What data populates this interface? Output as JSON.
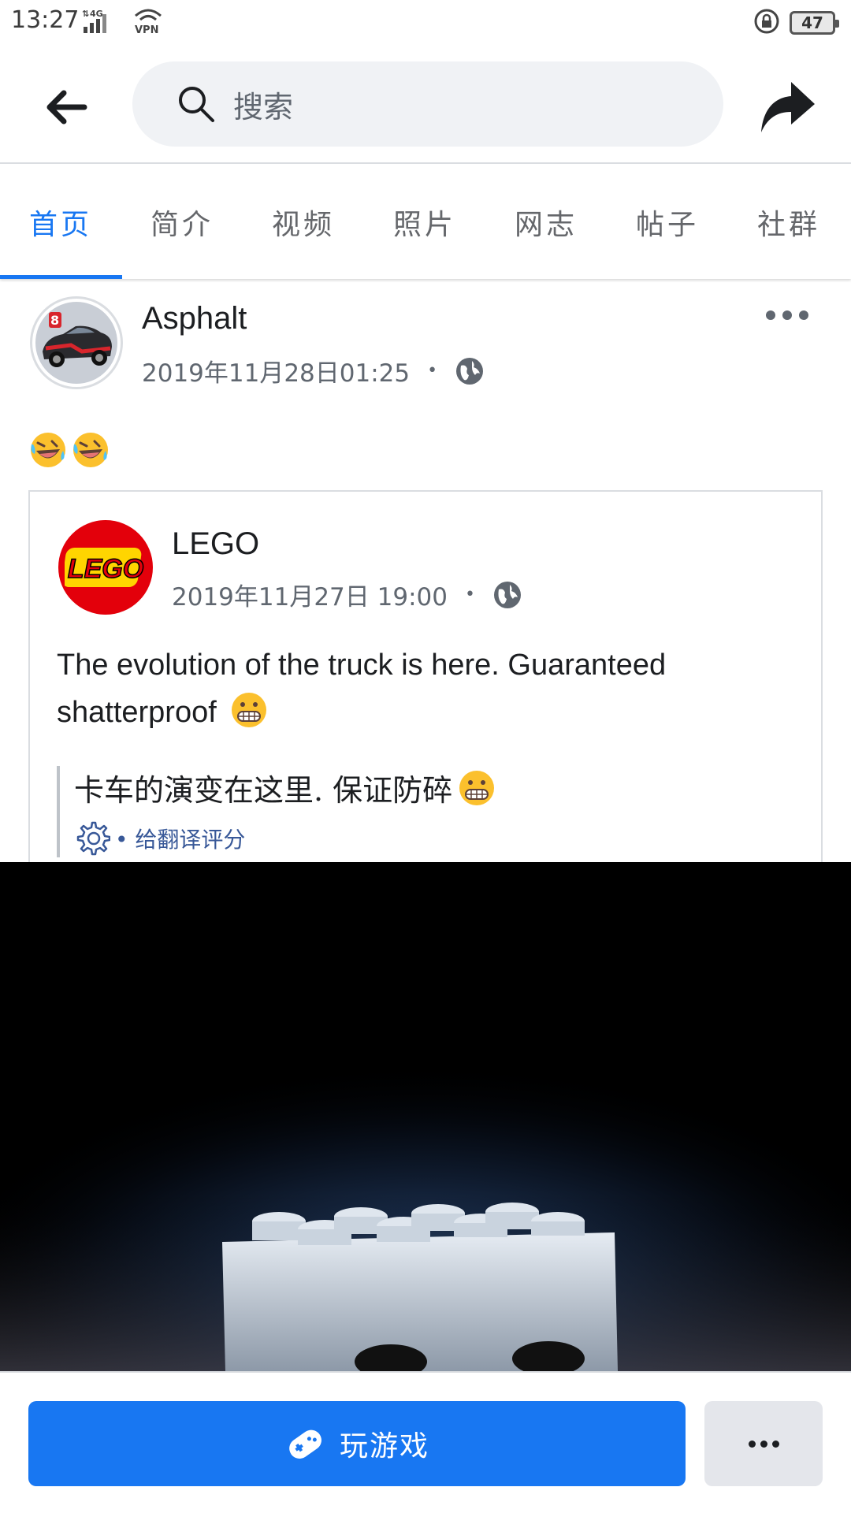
{
  "status_bar": {
    "time": "13:27",
    "network": "4G",
    "vpn": "VPN",
    "battery": "47"
  },
  "header": {
    "search_placeholder": "搜索"
  },
  "tabs": [
    {
      "label": "首页",
      "active": true
    },
    {
      "label": "简介",
      "active": false
    },
    {
      "label": "视频",
      "active": false
    },
    {
      "label": "照片",
      "active": false
    },
    {
      "label": "网志",
      "active": false
    },
    {
      "label": "帖子",
      "active": false
    },
    {
      "label": "社群",
      "active": false
    }
  ],
  "post": {
    "author": "Asphalt",
    "timestamp": "2019年11月28日01:25",
    "visibility_icon": "globe-icon",
    "shared": {
      "author": "LEGO",
      "logo_text": "LEGO",
      "timestamp": "2019年11月27日 19:00",
      "visibility_icon": "globe-icon",
      "text": "The evolution of the truck is here. Guaranteed shatterproof",
      "translation": "卡车的演变在这里. 保证防碎",
      "rate_translation": "• 给翻译评分"
    }
  },
  "bottom": {
    "play_label": "玩游戏"
  },
  "colors": {
    "accent": "#1877f2",
    "lego_red": "#e3000b",
    "link": "#385898"
  }
}
